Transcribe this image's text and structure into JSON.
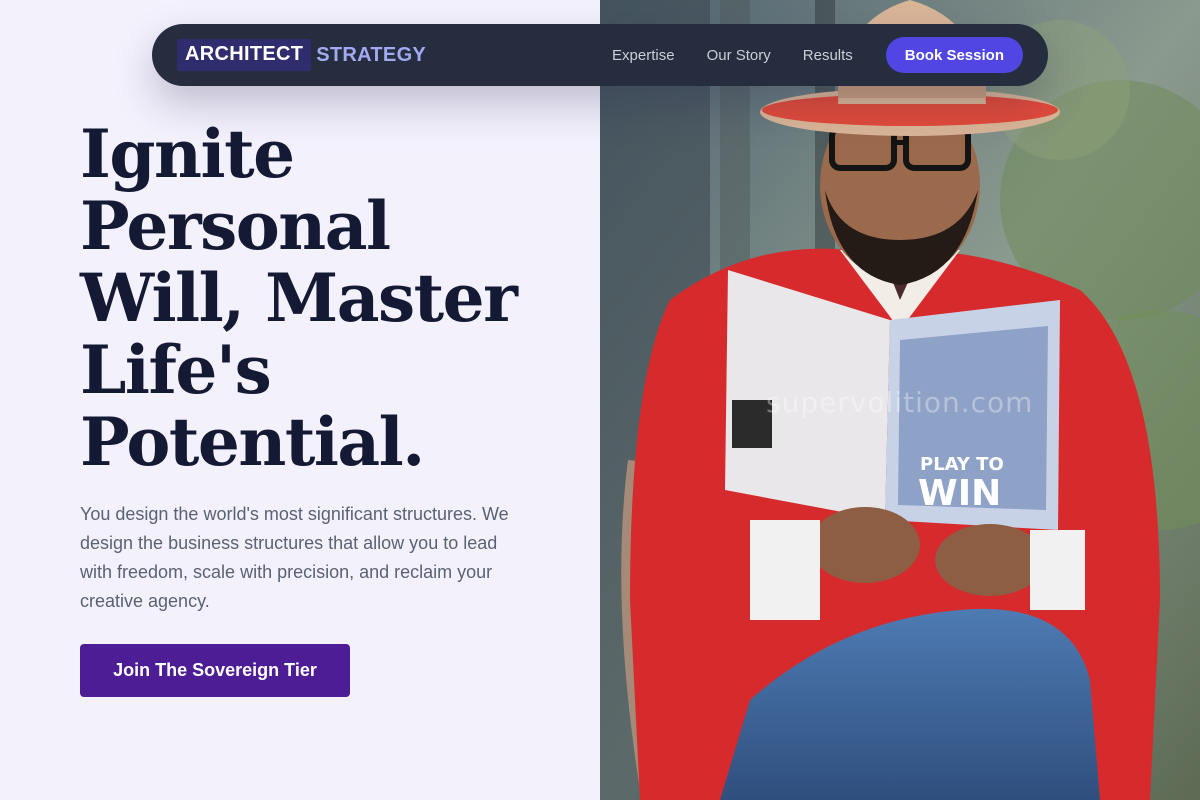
{
  "nav": {
    "logo_main": "ARCHITECT",
    "logo_accent": "STRATEGY",
    "links": [
      "Expertise",
      "Our Story",
      "Results"
    ],
    "cta_label": "Book Session"
  },
  "hero": {
    "headline": "Ignite Personal Will, Master Life's Potential.",
    "subcopy": "You design the world's most significant structures. We design the business structures that allow you to lead with freedom, scale with precision, and reclaim your creative agency.",
    "cta_label": "Join The Sovereign Tier"
  },
  "photo": {
    "watermark": "supervolition.com",
    "book_title_line1": "PLAY TO",
    "book_title_line2": "WIN"
  },
  "colors": {
    "page_bg": "#f3f1fc",
    "nav_bg": "#252d3e",
    "nav_cta": "#5146e4",
    "hero_cta": "#4d1d96",
    "headline": "#141a33",
    "jacket": "#d62a2c"
  }
}
